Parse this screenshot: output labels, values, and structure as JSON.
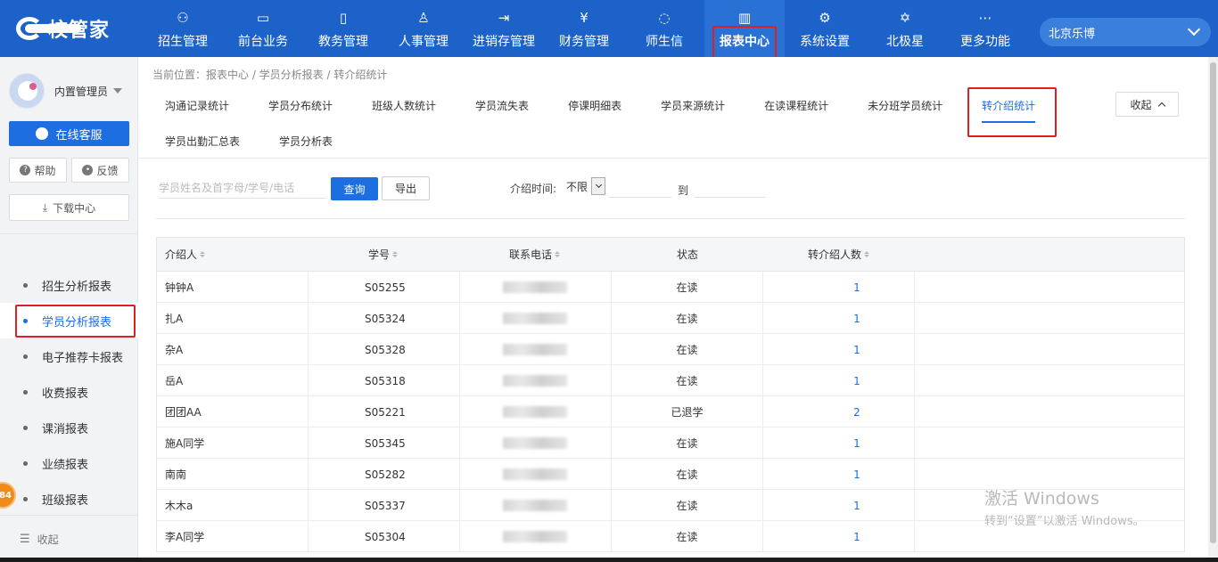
{
  "brand": {
    "name": "校管家"
  },
  "nav": {
    "items": [
      {
        "label": "招生管理",
        "icon": "person-add-icon",
        "glyph": "⚇"
      },
      {
        "label": "前台业务",
        "icon": "monitor-icon",
        "glyph": "▭"
      },
      {
        "label": "教务管理",
        "icon": "book-icon",
        "glyph": "▯"
      },
      {
        "label": "人事管理",
        "icon": "person-icon",
        "glyph": "♙"
      },
      {
        "label": "进销存管理",
        "icon": "exchange-icon",
        "glyph": "⇥"
      },
      {
        "label": "财务管理",
        "icon": "yen-icon",
        "glyph": "¥"
      },
      {
        "label": "师生信",
        "icon": "chat-icon",
        "glyph": "◌"
      },
      {
        "label": "报表中心",
        "icon": "chart-icon",
        "glyph": "▥"
      },
      {
        "label": "系统设置",
        "icon": "gear-icon",
        "glyph": "⚙"
      },
      {
        "label": "北极星",
        "icon": "star-icon",
        "glyph": "✡"
      },
      {
        "label": "更多功能",
        "icon": "more-icon",
        "glyph": "⋯"
      }
    ],
    "active_index": 7,
    "school": "北京乐博"
  },
  "sidebar": {
    "user_name": "内置管理员",
    "service_label": "在线客服",
    "help_label": "帮助",
    "feedback_label": "反馈",
    "download_label": "下载中心",
    "menu": [
      {
        "label": "招生分析报表"
      },
      {
        "label": "学员分析报表"
      },
      {
        "label": "电子推荐卡报表"
      },
      {
        "label": "收费报表"
      },
      {
        "label": "课消报表"
      },
      {
        "label": "业绩报表"
      },
      {
        "label": "班级报表"
      }
    ],
    "active_index": 1,
    "collapse_label": "收起",
    "badge": "84"
  },
  "main": {
    "breadcrumb": "当前位置：报表中心 / 学员分析报表 / 转介绍统计",
    "tabs_row1": [
      "沟通记录统计",
      "学员分布统计",
      "班级人数统计",
      "学员流失表",
      "停课明细表",
      "学员来源统计",
      "在读课程统计",
      "未分班学员统计",
      "转介绍统计"
    ],
    "tabs_row2": [
      "学员出勤汇总表",
      "学员分析表"
    ],
    "active_tab": "转介绍统计",
    "fold_label": "收起",
    "search_placeholder": "学员姓名及首字母/学号/电话",
    "query_label": "查询",
    "export_label": "导出",
    "time_label": "介绍时间:",
    "time_value": "不限",
    "to_label": "到"
  },
  "table": {
    "headers": [
      "介绍人",
      "学号",
      "联系电话",
      "状态",
      "转介绍人数"
    ],
    "rows": [
      {
        "name": "钟钟A",
        "id": "S05255",
        "status": "在读",
        "count": "1"
      },
      {
        "name": "扎A",
        "id": "S05324",
        "status": "在读",
        "count": "1"
      },
      {
        "name": "杂A",
        "id": "S05328",
        "status": "在读",
        "count": "1"
      },
      {
        "name": "岳A",
        "id": "S05318",
        "status": "在读",
        "count": "1"
      },
      {
        "name": "团团AA",
        "id": "S05221",
        "status": "已退学",
        "count": "2"
      },
      {
        "name": "施A同学",
        "id": "S05345",
        "status": "在读",
        "count": "1"
      },
      {
        "name": "南南",
        "id": "S05282",
        "status": "在读",
        "count": "1"
      },
      {
        "name": "木木a",
        "id": "S05337",
        "status": "在读",
        "count": "1"
      },
      {
        "name": "李A同学",
        "id": "S05304",
        "status": "在读",
        "count": "1"
      }
    ]
  },
  "watermark": {
    "line1": "激活 Windows",
    "line2": "转到“设置”以激活 Windows。"
  },
  "colors": {
    "primary": "#1d62c8",
    "accent": "#1d6ee0",
    "highlight": "#e02020"
  }
}
